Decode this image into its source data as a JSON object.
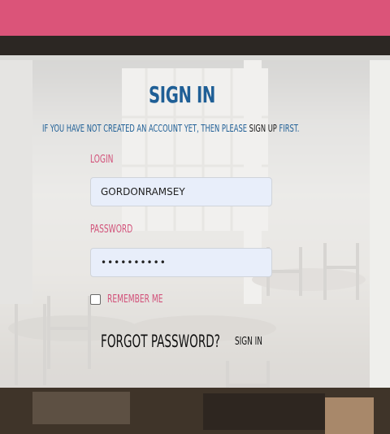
{
  "colors": {
    "top_bar": "#db5479",
    "title": "#1f5f96",
    "label": "#d2527a",
    "input_bg": "#e8eefa"
  },
  "signin": {
    "title": "Sign In",
    "subtitle_before": "If you have not created an account yet, then please ",
    "signup_link": "sign up",
    "subtitle_after": " first.",
    "login_label": "Login",
    "login_value": "gordonramsey",
    "password_label": "Password",
    "password_value": "••••••••••",
    "remember_label": "Remember me",
    "remember_checked": false,
    "forgot_label": "Forgot password?",
    "submit_label": "Sign In"
  }
}
